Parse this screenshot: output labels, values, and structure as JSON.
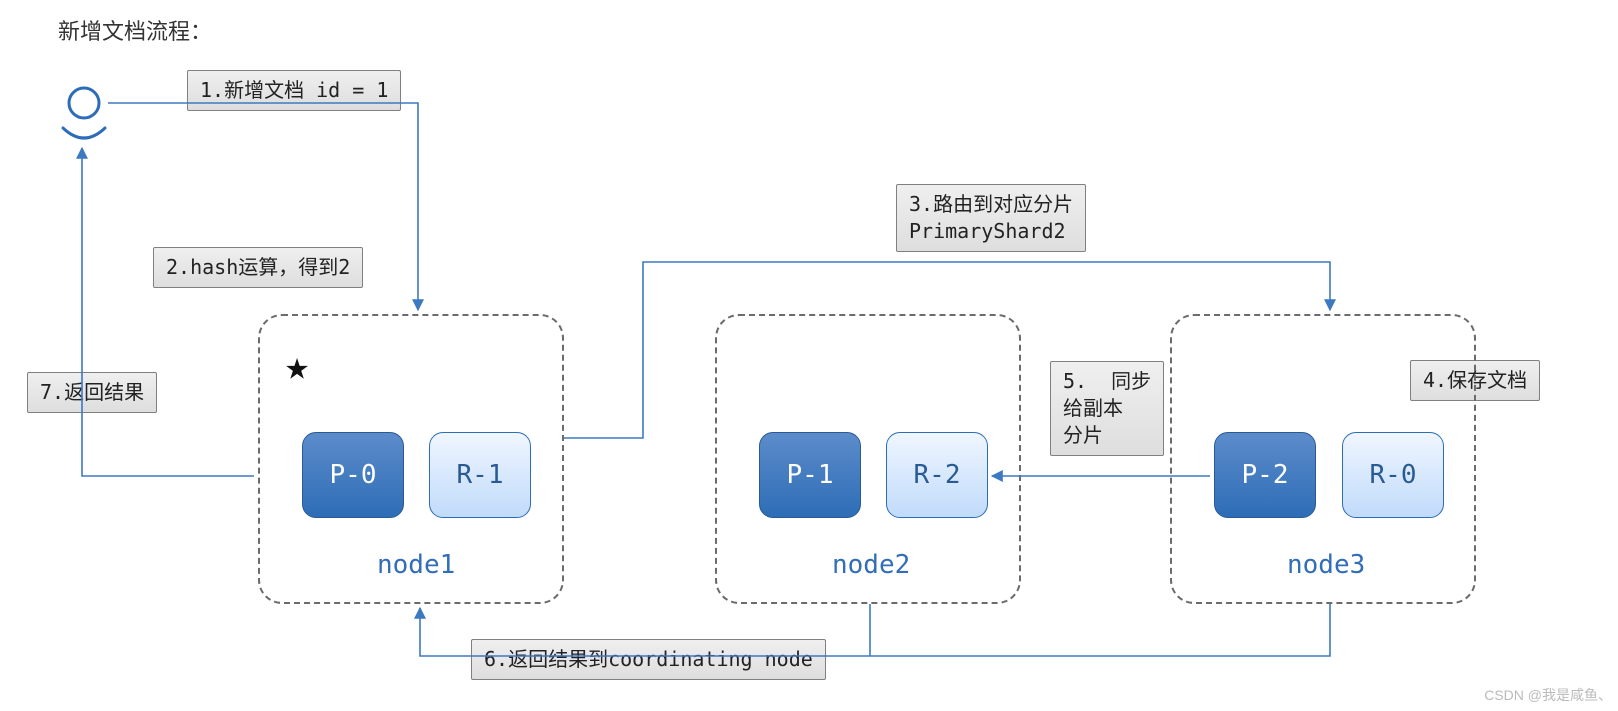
{
  "title": "新增文档流程：",
  "steps": {
    "s1": "1.新增文档 id = 1",
    "s2": "2.hash运算，得到2",
    "s3": "3.路由到对应分片\nPrimaryShard2",
    "s4": "4.保存文档",
    "s5": "5.  同步\n给副本\n分片",
    "s6": "6.返回结果到coordinating node",
    "s7": "7.返回结果"
  },
  "nodes": {
    "node1": {
      "label": "node1",
      "primary": "P-0",
      "replica": "R-1"
    },
    "node2": {
      "label": "node2",
      "primary": "P-1",
      "replica": "R-2"
    },
    "node3": {
      "label": "node3",
      "primary": "P-2",
      "replica": "R-0"
    }
  },
  "colors": {
    "arrow": "#3d79c1",
    "actor": "#2d6db8",
    "box_bg": "#e4e4e4",
    "box_border": "#808080"
  },
  "watermark": "CSDN @我是咸鱼、"
}
